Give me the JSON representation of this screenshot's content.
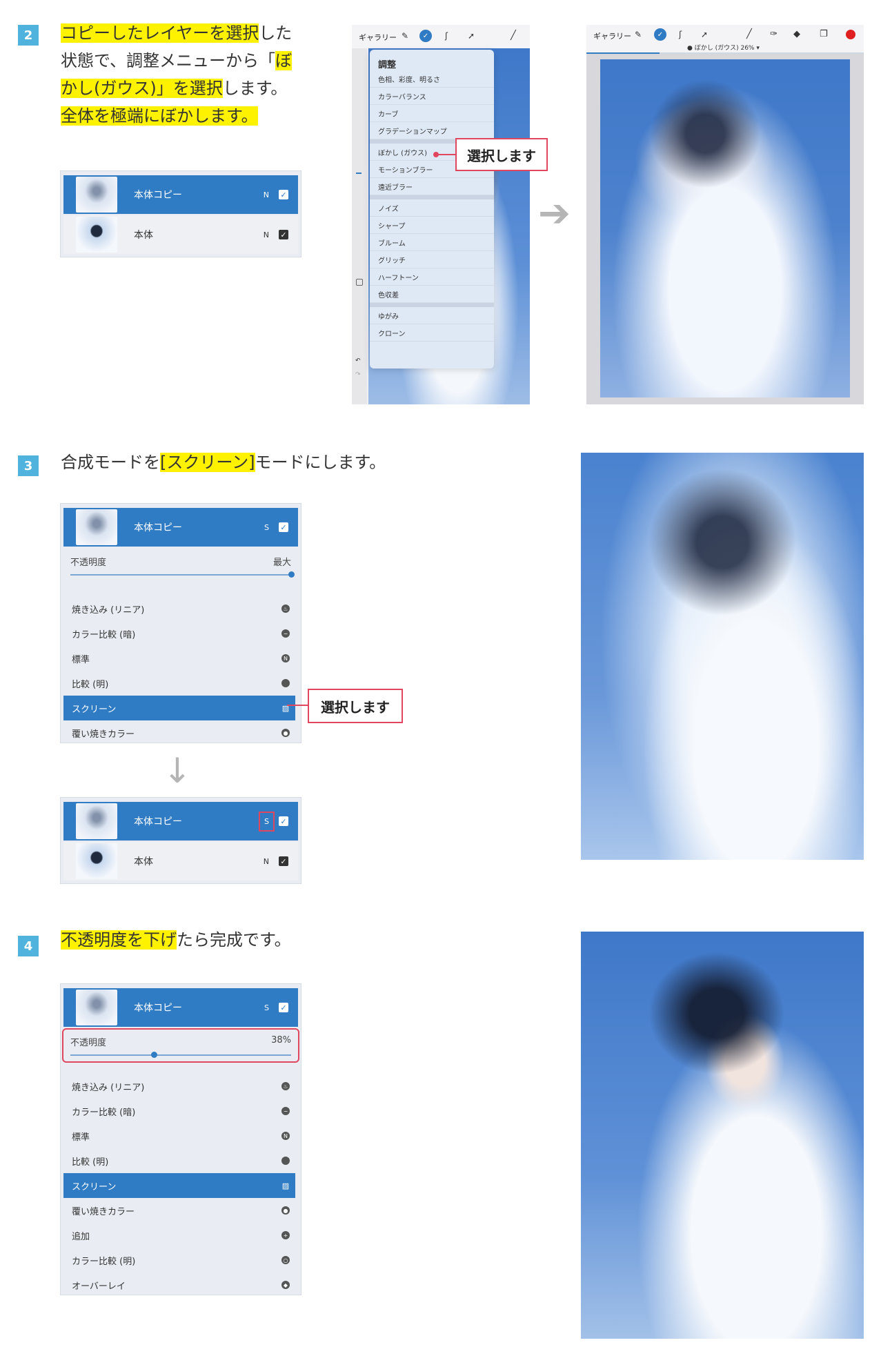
{
  "step2": {
    "num": "2",
    "line1_hl": "コピーしたレイヤーを選択",
    "line1_rest": "した",
    "line2_pre": "状態で、調整メニューから「",
    "line2_hl": "ぼ",
    "line3_hl": "かし(ガウス)」を選択",
    "line3_rest": "します。",
    "line4_hl": "全体を極端にぼかします。"
  },
  "step3": {
    "num": "3",
    "text_pre": "合成モードを",
    "text_hl": "[スクリーン]",
    "text_rest": "モードにします。"
  },
  "step4": {
    "num": "4",
    "text_hl": "不透明度を下げ",
    "text_rest": "たら完成です。"
  },
  "layers": {
    "copy_name": "本体コピー",
    "base_name": "本体",
    "mode_normal": "N",
    "mode_screen": "S",
    "check": "✓"
  },
  "opacity": {
    "label": "不透明度",
    "max_value": "最大",
    "value_38": "38%",
    "level_max": 1.0,
    "level_final": 0.38
  },
  "blend_modes_short": [
    {
      "label": "焼き込み (リニア)",
      "icon": "flame-icon",
      "glyph": "♨"
    },
    {
      "label": "カラー比較 (暗)",
      "icon": "minus-circle-icon",
      "glyph": "−"
    },
    {
      "label": "標準",
      "icon": "n-square-icon",
      "glyph": "N"
    },
    {
      "label": "比較 (明)",
      "icon": "circle-icon",
      "glyph": ""
    },
    {
      "label": "スクリーン",
      "icon": "hatch-icon",
      "glyph": "▨",
      "active": true
    },
    {
      "label": "覆い焼きカラー",
      "icon": "pin-icon",
      "glyph": "●"
    }
  ],
  "blend_modes_long": [
    {
      "label": "焼き込み (リニア)",
      "glyph": "♨"
    },
    {
      "label": "カラー比較 (暗)",
      "glyph": "−"
    },
    {
      "label": "標準",
      "glyph": "N"
    },
    {
      "label": "比較 (明)",
      "glyph": ""
    },
    {
      "label": "スクリーン",
      "glyph": "▨",
      "active": true
    },
    {
      "label": "覆い焼きカラー",
      "glyph": "●"
    },
    {
      "label": "追加",
      "glyph": "+"
    },
    {
      "label": "カラー比較 (明)",
      "glyph": "○"
    },
    {
      "label": "オーバーレイ",
      "glyph": "◆"
    }
  ],
  "callout": {
    "select_label": "選択します"
  },
  "app": {
    "gallery": "ギャラリー",
    "blur_status": "ぼかし (ガウス) 26%"
  },
  "adjust_menu": {
    "title": "調整",
    "group1": [
      "色相、彩度、明るさ",
      "カラーバランス",
      "カーブ",
      "グラデーションマップ"
    ],
    "group2": [
      "ぼかし (ガウス)",
      "モーションブラー",
      "遠近ブラー"
    ],
    "group3": [
      "ノイズ",
      "シャープ",
      "ブルーム",
      "グリッチ",
      "ハーフトーン",
      "色収差"
    ],
    "group4": [
      "ゆがみ",
      "クローン"
    ]
  },
  "colors": {
    "accent_blue": "#2f7bc4",
    "step_badge": "#4fb3de",
    "highlight": "#fff200",
    "callout_red": "#e0475e"
  }
}
